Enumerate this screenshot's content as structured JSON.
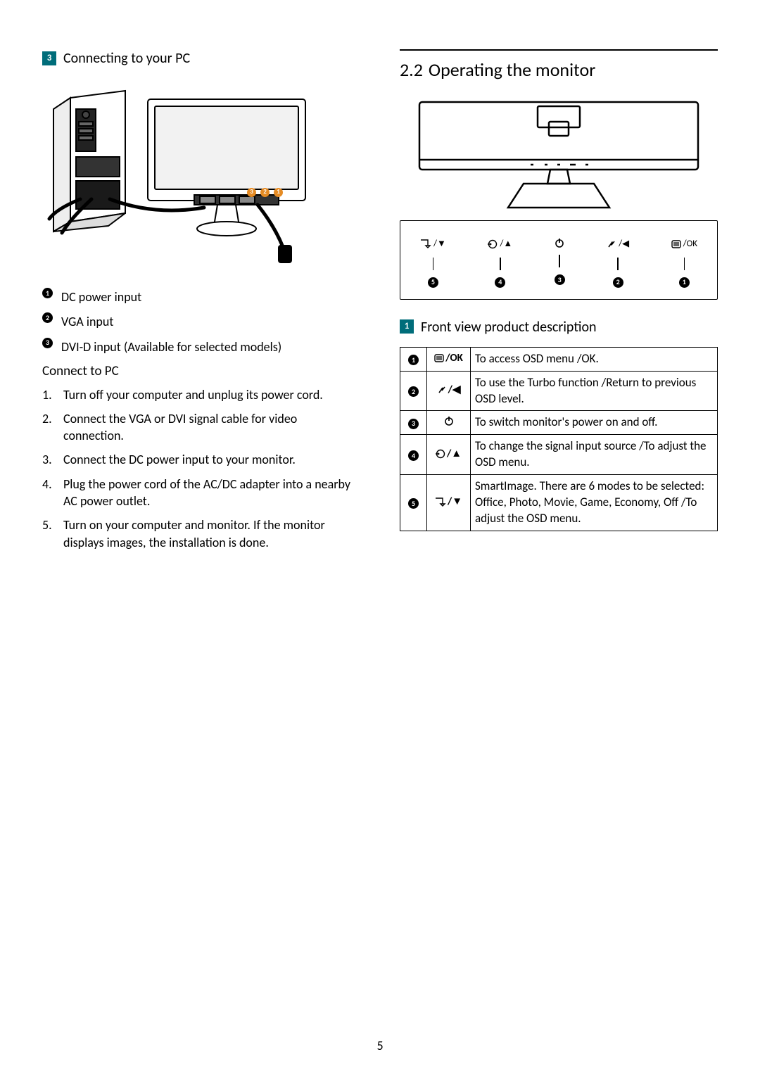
{
  "page_number": "5",
  "left": {
    "section_tag": "3",
    "section_title": "Connecting to your PC",
    "port_callouts": [
      "3",
      "2",
      "1"
    ],
    "ports": [
      {
        "num": "1",
        "label": "DC power input"
      },
      {
        "num": "2",
        "label": "VGA input"
      },
      {
        "num": "3",
        "label": "DVI-D input (Available for selected models)"
      }
    ],
    "connect_heading": "Connect to PC",
    "steps": [
      "Turn off your computer and unplug its power cord.",
      "Connect the VGA or DVI signal cable for video connection.",
      "Connect the DC power input to your monitor.",
      "Plug the power cord of the AC/DC adapter into a nearby AC power outlet.",
      "Turn on your computer and monitor. If the monitor displays images, the installation is done."
    ]
  },
  "right": {
    "section_number": "2.2",
    "section_title": "Operating the monitor",
    "controls": [
      {
        "glyph": "smart-down",
        "label": "⬚/▼",
        "num": "5"
      },
      {
        "glyph": "input-up",
        "label": "⊕/▲",
        "num": "4"
      },
      {
        "glyph": "power",
        "label": "⏻",
        "num": "3"
      },
      {
        "glyph": "turbo-left",
        "label": "⤾/◀",
        "num": "2"
      },
      {
        "glyph": "menu-ok",
        "label": "▤/OK",
        "num": "1"
      }
    ],
    "subsection_tag": "1",
    "subsection_title": "Front view product description",
    "table": [
      {
        "num": "1",
        "sym": "menu-ok",
        "desc": "To access OSD menu /OK."
      },
      {
        "num": "2",
        "sym": "turbo-left",
        "desc": "To use the Turbo function /Return to previous OSD level."
      },
      {
        "num": "3",
        "sym": "power",
        "desc": "To switch monitor's power on and off."
      },
      {
        "num": "4",
        "sym": "input-up",
        "desc": "To change the signal input source /To adjust the OSD menu."
      },
      {
        "num": "5",
        "sym": "smart-down",
        "desc": "SmartImage. There are 6 modes to be selected: Office, Photo, Movie, Game, Economy, Off /To adjust the OSD menu."
      }
    ]
  }
}
